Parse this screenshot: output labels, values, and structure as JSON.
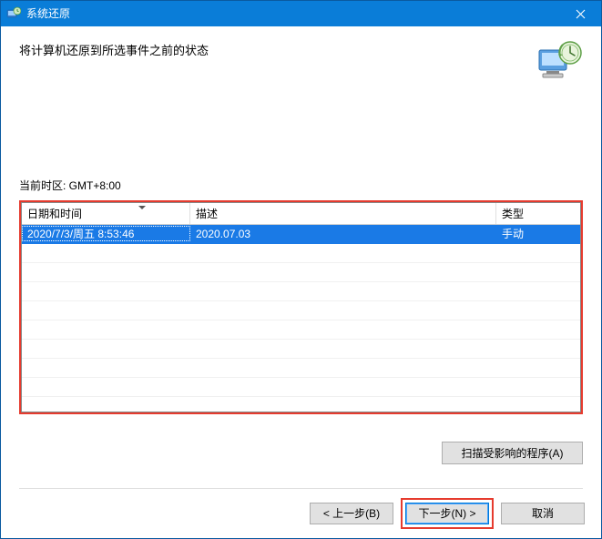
{
  "window": {
    "title": "系统还原"
  },
  "header": {
    "subtitle": "将计算机还原到所选事件之前的状态"
  },
  "timezone_label": "当前时区: GMT+8:00",
  "table": {
    "headers": {
      "datetime": "日期和时间",
      "description": "描述",
      "type": "类型"
    },
    "rows": [
      {
        "datetime": "2020/7/3/周五 8:53:46",
        "description": "2020.07.03",
        "type": "手动"
      }
    ]
  },
  "buttons": {
    "scan": "扫描受影响的程序(A)",
    "back": "< 上一步(B)",
    "next": "下一步(N) >",
    "cancel": "取消"
  }
}
